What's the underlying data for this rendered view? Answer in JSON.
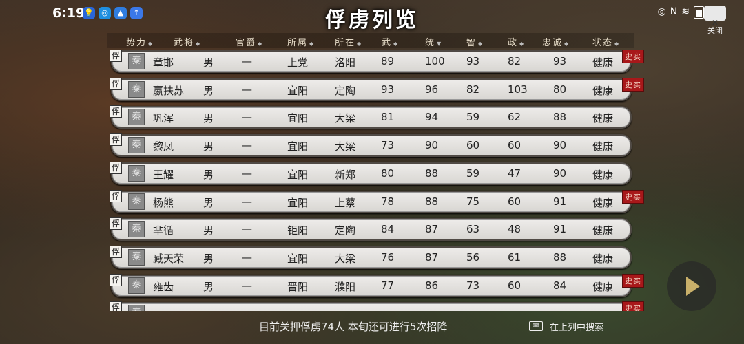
{
  "status": {
    "time": "6:19",
    "nfc_icon": "N",
    "close_label": "关闭"
  },
  "title": "俘虏列览",
  "headers": {
    "force": "势力",
    "general": "武将",
    "rank": "官爵",
    "belong": "所属",
    "location": "所在",
    "war": "武",
    "lead": "统",
    "intel": "智",
    "pol": "政",
    "loyalty": "忠诚",
    "state": "状态"
  },
  "rows": [
    {
      "fu": "俘",
      "faction": "秦",
      "name": "章邯",
      "sex": "男",
      "rank": "—",
      "belong": "上党",
      "location": "洛阳",
      "war": "89",
      "lead": "100",
      "intel": "93",
      "pol": "82",
      "loyalty": "93",
      "state": "健康",
      "hist": "史实"
    },
    {
      "fu": "俘",
      "faction": "秦",
      "name": "嬴扶苏",
      "sex": "男",
      "rank": "—",
      "belong": "宜阳",
      "location": "定陶",
      "war": "93",
      "lead": "96",
      "intel": "82",
      "pol": "103",
      "loyalty": "80",
      "state": "健康",
      "hist": "史实"
    },
    {
      "fu": "俘",
      "faction": "秦",
      "name": "巩浑",
      "sex": "男",
      "rank": "—",
      "belong": "宜阳",
      "location": "大梁",
      "war": "81",
      "lead": "94",
      "intel": "59",
      "pol": "62",
      "loyalty": "88",
      "state": "健康",
      "hist": ""
    },
    {
      "fu": "俘",
      "faction": "秦",
      "name": "黎凤",
      "sex": "男",
      "rank": "—",
      "belong": "宜阳",
      "location": "大梁",
      "war": "73",
      "lead": "90",
      "intel": "60",
      "pol": "60",
      "loyalty": "90",
      "state": "健康",
      "hist": ""
    },
    {
      "fu": "俘",
      "faction": "秦",
      "name": "王耀",
      "sex": "男",
      "rank": "—",
      "belong": "宜阳",
      "location": "新郑",
      "war": "80",
      "lead": "88",
      "intel": "59",
      "pol": "47",
      "loyalty": "90",
      "state": "健康",
      "hist": ""
    },
    {
      "fu": "俘",
      "faction": "秦",
      "name": "杨熊",
      "sex": "男",
      "rank": "—",
      "belong": "宜阳",
      "location": "上蔡",
      "war": "78",
      "lead": "88",
      "intel": "75",
      "pol": "60",
      "loyalty": "91",
      "state": "健康",
      "hist": "史实"
    },
    {
      "fu": "俘",
      "faction": "秦",
      "name": "芈循",
      "sex": "男",
      "rank": "—",
      "belong": "钜阳",
      "location": "定陶",
      "war": "84",
      "lead": "87",
      "intel": "63",
      "pol": "48",
      "loyalty": "91",
      "state": "健康",
      "hist": ""
    },
    {
      "fu": "俘",
      "faction": "秦",
      "name": "臧天荣",
      "sex": "男",
      "rank": "—",
      "belong": "宜阳",
      "location": "大梁",
      "war": "76",
      "lead": "87",
      "intel": "56",
      "pol": "61",
      "loyalty": "88",
      "state": "健康",
      "hist": ""
    },
    {
      "fu": "俘",
      "faction": "秦",
      "name": "雍齿",
      "sex": "男",
      "rank": "—",
      "belong": "晋阳",
      "location": "濮阳",
      "war": "77",
      "lead": "86",
      "intel": "73",
      "pol": "60",
      "loyalty": "84",
      "state": "健康",
      "hist": "史实"
    },
    {
      "fu": "俘",
      "faction": "秦",
      "name": "",
      "sex": "",
      "rank": "",
      "belong": "",
      "location": "",
      "war": "",
      "lead": "",
      "intel": "",
      "pol": "",
      "loyalty": "",
      "state": "",
      "hist": "史实"
    }
  ],
  "bottom": {
    "summary": "目前关押俘虏74人  本旬还可进行5次招降",
    "search": "在上列中搜索"
  }
}
